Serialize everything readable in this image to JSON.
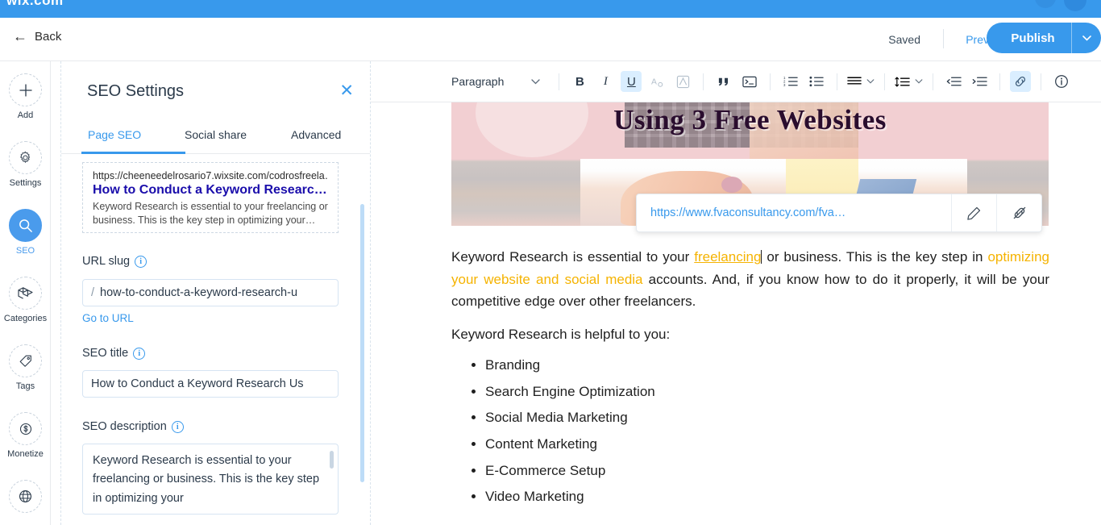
{
  "appbar": {
    "logo": "wix.com"
  },
  "header": {
    "back_label": "Back",
    "saved_label": "Saved",
    "preview_label": "Preview",
    "publish_label": "Publish",
    "publish_caret": "⌄",
    "accent_color": "#3899ec"
  },
  "rail": {
    "items": [
      {
        "label": "Add",
        "icon": "plus-icon",
        "active": false
      },
      {
        "label": "Settings",
        "icon": "gear-icon",
        "active": false
      },
      {
        "label": "SEO",
        "icon": "search-icon",
        "active": true
      },
      {
        "label": "Categories",
        "icon": "cards-icon",
        "active": false
      },
      {
        "label": "Tags",
        "icon": "tag-icon",
        "active": false
      },
      {
        "label": "Monetize",
        "icon": "dollar-icon",
        "active": false
      },
      {
        "label": "",
        "icon": "globe-icon",
        "active": false
      }
    ]
  },
  "seo_panel": {
    "title": "SEO Settings",
    "close_icon": "✕",
    "tabs": [
      {
        "label": "Page SEO",
        "active": true
      },
      {
        "label": "Social share",
        "active": false
      },
      {
        "label": "Advanced",
        "active": false
      }
    ],
    "preview": {
      "url": "https://cheeneedelrosario7.wixsite.com/codrosfreela…",
      "title": "How to Conduct a Keyword Researc…",
      "description": "Keyword Research is essential to your freelancing or business. This is the key step in optimizing your…"
    },
    "url_slug": {
      "label": "URL slug",
      "info_icon": "i",
      "prefix": "/",
      "value": "how-to-conduct-a-keyword-research-u",
      "go_to_url": "Go to URL"
    },
    "seo_title": {
      "label": "SEO title",
      "info_icon": "i",
      "value": "How to Conduct a Keyword Research Us"
    },
    "seo_description": {
      "label": "SEO description",
      "info_icon": "i",
      "value": "Keyword Research is essential to your freelancing or business. This is the key step in optimizing your"
    }
  },
  "editor_toolbar": {
    "paragraph_label": "Paragraph",
    "caret": "⌄",
    "buttons": [
      {
        "name": "bold-icon",
        "glyph": "B",
        "state": "normal"
      },
      {
        "name": "italic-icon",
        "glyph": "I",
        "state": "normal"
      },
      {
        "name": "underline-icon",
        "glyph": "U",
        "state": "active"
      },
      {
        "name": "text-color-icon",
        "glyph": "A",
        "state": "dim"
      },
      {
        "name": "highlight-icon",
        "glyph": "A",
        "state": "dim"
      },
      {
        "name": "blockquote-icon",
        "glyph": "”",
        "state": "normal"
      },
      {
        "name": "code-block-icon",
        "glyph": ">_",
        "state": "normal"
      },
      {
        "name": "ordered-list-icon",
        "glyph": "1.",
        "state": "normal"
      },
      {
        "name": "bulleted-list-icon",
        "glyph": "•",
        "state": "normal"
      },
      {
        "name": "text-align-icon",
        "glyph": "≡",
        "state": "normal"
      },
      {
        "name": "line-spacing-icon",
        "glyph": "↕",
        "state": "normal"
      },
      {
        "name": "decrease-indent-icon",
        "glyph": "←",
        "state": "normal"
      },
      {
        "name": "increase-indent-icon",
        "glyph": "→",
        "state": "normal"
      },
      {
        "name": "link-icon",
        "glyph": "🔗",
        "state": "link-active"
      },
      {
        "name": "info-icon",
        "glyph": "i",
        "state": "normal"
      }
    ]
  },
  "article": {
    "banner_heading": "Using 3 Free Websites",
    "link_popup": {
      "url": "https://www.fvaconsultancy.com/fva…",
      "edit_icon": "pencil-icon",
      "unlink_icon": "unlink-icon"
    },
    "paragraph": {
      "p1": "Keyword Research is essential to your ",
      "link": "freelancing",
      "p2": " or business. This is the key step in ",
      "highlight": "optimizing your website and social media",
      "p3": " accounts. And, if you know how to do it properly, it will be your competitive edge over other freelancers."
    },
    "subheading": "Keyword Research is helpful to you:",
    "bullets": [
      "Branding",
      "Search Engine Optimization",
      "Social Media Marketing",
      "Content Marketing",
      "E-Commerce Setup",
      "Video Marketing"
    ]
  }
}
